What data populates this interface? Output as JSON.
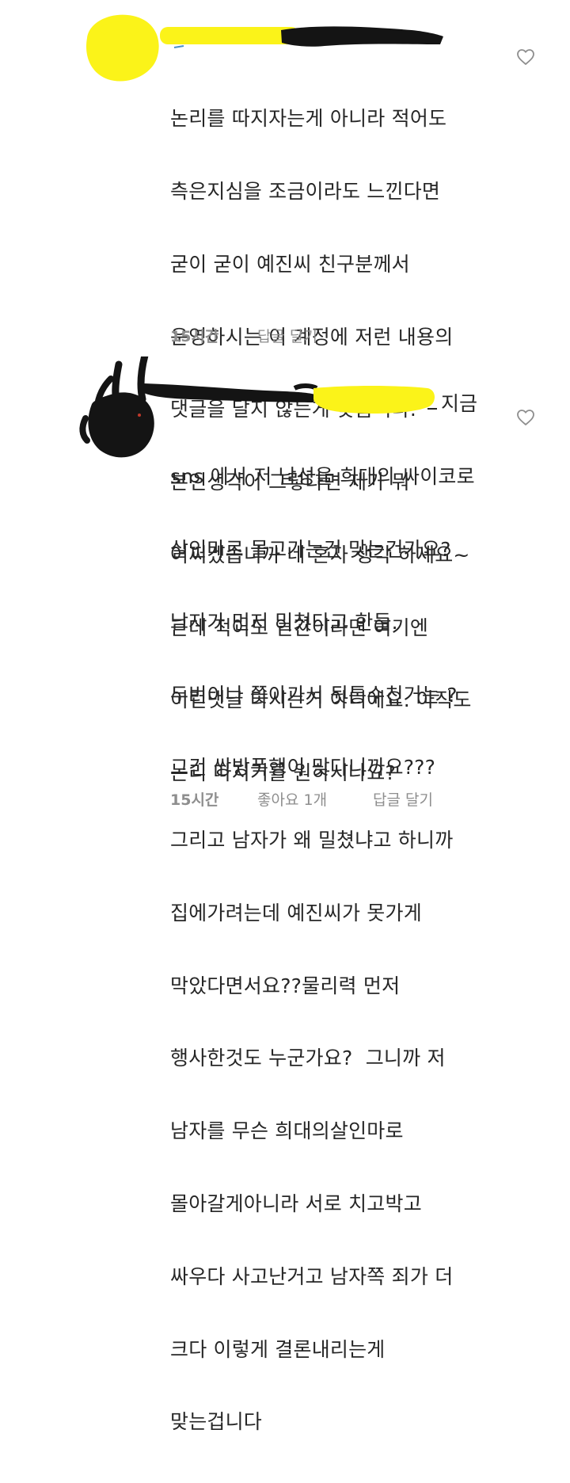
{
  "comments": [
    {
      "header_redacted": true,
      "body_lines": [
        "논리를 따지자는게 아니라 적어도",
        "측은지심을 조금이라도 느낀다면",
        "굳이 굳이 예진씨 친구분께서",
        "운영하시는 이 계정에 저런 내용의",
        "댓글을 달지 않는게 맞습니다.",
        "본인생각이 그렇다면 제가 뭐",
        "어쩌겠습니까 네 혼자 생각 하세요~",
        "근데 적어도 인간이라면 여기엔",
        "이런댓글 다시는거 아니에요. 아직도",
        "논리 따지기를 원하시나요?"
      ],
      "time": "15시간",
      "reply_label": "답글 달기",
      "like_icon": "heart-outline-icon"
    },
    {
      "header_redacted": true,
      "first_line_tail": "지금",
      "body_lines": [
        "sns 에서 저 남성을 희대의 싸이코로",
        "살인마로 몰고가는건 맞는건가요?",
        "남자가 먼저 밀쳤다고 한들.",
        "두번이나 쫓아가서 뒷통수친거는 ?",
        "그건 쌍방폭행이 맞다니까요???",
        "그리고 남자가 왜 밀쳤냐고 하니까",
        "집에가려는데 예진씨가 못가게",
        "막았다면서요??물리력 먼저",
        "행사한것도 누군가요?  그니까 저",
        "남자를 무슨 희대의살인마로",
        "몰아갈게아니라 서로 치고박고",
        "싸우다 사고난거고 남자쪽 죄가 더",
        "크다 이렇게 결론내리는게",
        "맞는겁니다"
      ],
      "time": "15시간",
      "likes_label": "좋아요 1개",
      "reply_label": "답글 달기",
      "like_icon": "heart-outline-icon"
    }
  ],
  "colors": {
    "text": "#262626",
    "meta": "#8e8e8e",
    "redaction_yellow": "#fbf319",
    "redaction_black": "#141414",
    "icon": "#8e8e8e"
  }
}
